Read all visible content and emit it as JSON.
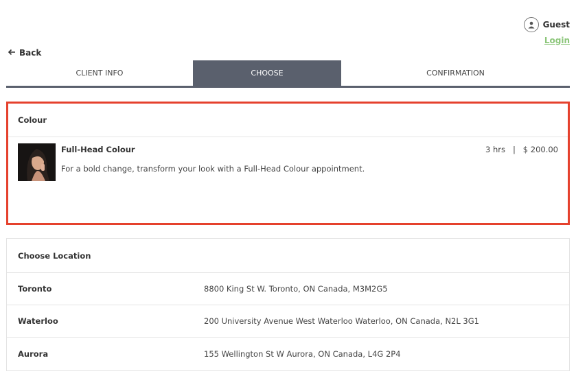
{
  "user": {
    "name": "Guest",
    "login_label": "Login"
  },
  "nav": {
    "back_label": "Back"
  },
  "tabs": [
    {
      "label": "CLIENT INFO"
    },
    {
      "label": "CHOOSE"
    },
    {
      "label": "CONFIRMATION"
    }
  ],
  "colour_section": {
    "title": "Colour",
    "service": {
      "name": "Full-Head Colour",
      "duration": "3 hrs",
      "separator": "|",
      "price": "$ 200.00",
      "description": "For a bold change, transform your look with a Full-Head Colour appointment."
    }
  },
  "location_section": {
    "title": "Choose Location",
    "locations": [
      {
        "city": "Toronto",
        "address": "8800 King St W. Toronto, ON Canada, M3M2G5"
      },
      {
        "city": "Waterloo",
        "address": "200 University Avenue West Waterloo Waterloo, ON Canada, N2L 3G1"
      },
      {
        "city": "Aurora",
        "address": "155 Wellington St W Aurora, ON Canada, L4G 2P4"
      }
    ]
  },
  "colors": {
    "accent_tab": "#5a606d",
    "highlight_border": "#e5412d",
    "login_green": "#8cc67a"
  }
}
